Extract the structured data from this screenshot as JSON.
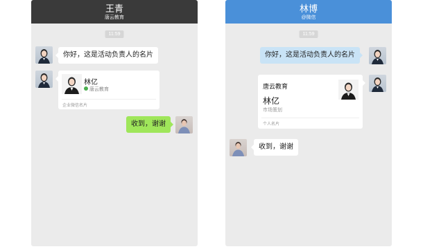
{
  "left_chat": {
    "header": {
      "title": "王青",
      "subtitle": "唐云教育"
    },
    "timestamp": "11:59",
    "messages": {
      "greeting": "你好，这是活动负责人的名片",
      "card": {
        "name": "林亿",
        "org": "唐云教育",
        "footer": "企业微信名片"
      },
      "reply": "收到，谢谢"
    }
  },
  "right_chat": {
    "header": {
      "title": "林博",
      "subtitle": "@微信"
    },
    "timestamp": "11:59",
    "messages": {
      "greeting": "你好，这是活动负责人的名片",
      "card": {
        "company": "唐云教育",
        "name": "林亿",
        "role": "市场策划",
        "footer": "个人名片"
      },
      "reply": "收到，谢谢"
    }
  },
  "colors": {
    "left_header": "#3a3a3a",
    "right_header": "#4a90d9",
    "chat_background": "#ebebeb",
    "green_bubble": "#9fe65a",
    "blue_bubble": "#c9e3f6"
  }
}
